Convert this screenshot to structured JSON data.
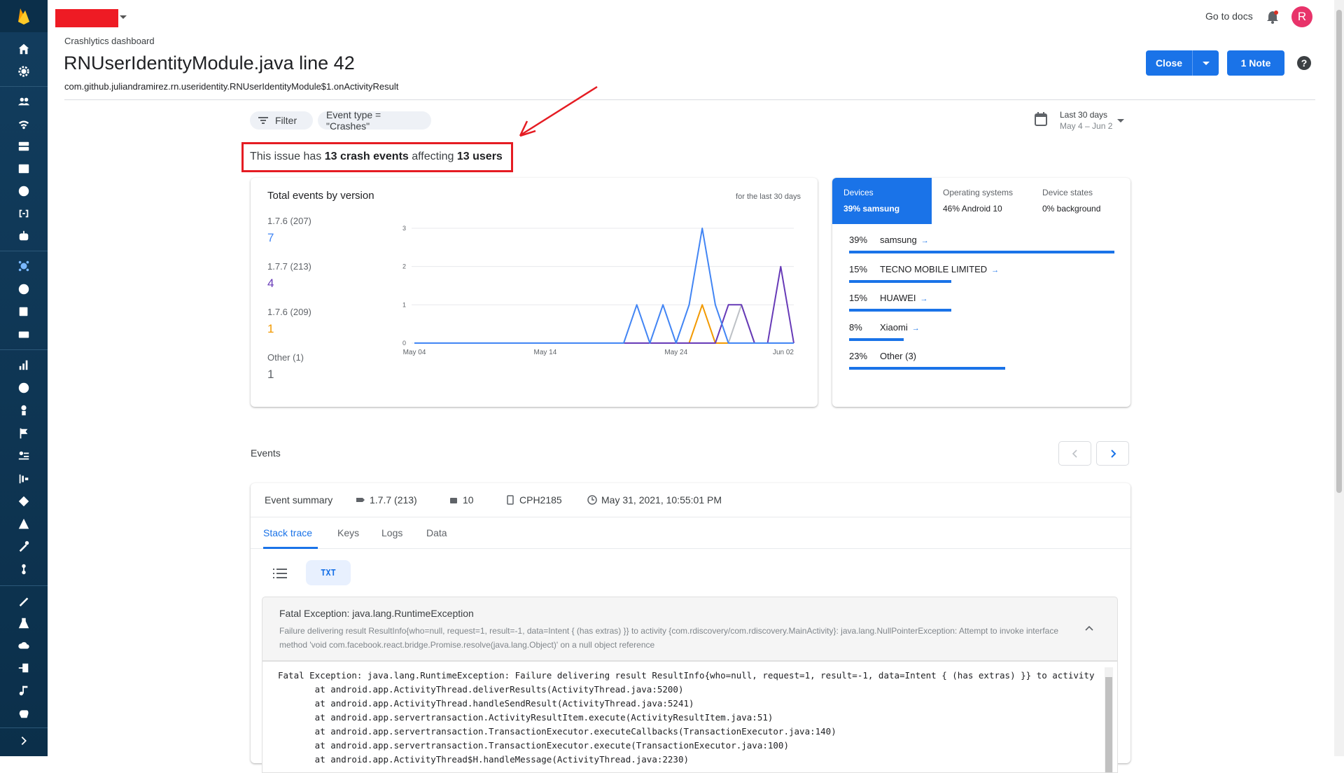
{
  "header": {
    "docs_link": "Go to docs",
    "avatar_letter": "R",
    "breadcrumb": "Crashlytics dashboard",
    "title": "RNUserIdentityModule.java line 42",
    "subtitle": "com.github.juliandramirez.rn.useridentity.RNUserIdentityModule$1.onActivityResult",
    "close_label": "Close",
    "note_label": "1 Note",
    "help_label": "?"
  },
  "filters": {
    "filter_label": "Filter",
    "event_type_label": "Event type = \"Crashes\"",
    "date_range_label": "Last 30 days",
    "date_range_value": "May 4 – Jun 2"
  },
  "summary": {
    "prefix": "This issue has ",
    "crash_events": "13 crash events",
    "middle": " affecting ",
    "users": "13 users"
  },
  "versions_card": {
    "title": "Total events by version",
    "note": "for the last 30 days",
    "versions": [
      {
        "label": "1.7.6 (207)",
        "count": "7",
        "color": "#4285f4"
      },
      {
        "label": "1.7.7 (213)",
        "count": "4",
        "color": "#673ab7"
      },
      {
        "label": "1.7.6 (209)",
        "count": "1",
        "color": "#f29900"
      },
      {
        "label": "Other (1)",
        "count": "1",
        "color": "#5f6368"
      }
    ]
  },
  "chart_data": {
    "type": "line",
    "title": "",
    "xlabel": "",
    "ylabel": "",
    "x": [
      "May 04",
      "May 05",
      "May 06",
      "May 07",
      "May 08",
      "May 09",
      "May 10",
      "May 11",
      "May 12",
      "May 13",
      "May 14",
      "May 15",
      "May 16",
      "May 17",
      "May 18",
      "May 19",
      "May 20",
      "May 21",
      "May 22",
      "May 23",
      "May 24",
      "May 25",
      "May 26",
      "May 27",
      "May 28",
      "May 29",
      "May 30",
      "May 31",
      "Jun 01",
      "Jun 02"
    ],
    "x_tick_labels": [
      "May 04",
      "May 14",
      "May 24",
      "Jun 02"
    ],
    "ylim": [
      0,
      3
    ],
    "y_ticks": [
      0,
      1,
      2,
      3
    ],
    "grid": true,
    "series": [
      {
        "color": "#4285f4",
        "values": [
          0,
          0,
          0,
          0,
          0,
          0,
          0,
          0,
          0,
          0,
          0,
          0,
          0,
          0,
          0,
          0,
          0,
          1,
          0,
          1,
          0,
          1,
          3,
          1,
          0,
          0,
          0,
          0,
          0,
          0
        ]
      },
      {
        "color": "#673ab7",
        "values": [
          0,
          0,
          0,
          0,
          0,
          0,
          0,
          0,
          0,
          0,
          0,
          0,
          0,
          0,
          0,
          0,
          0,
          0,
          0,
          0,
          0,
          0,
          0,
          0,
          1,
          1,
          0,
          0,
          2,
          0
        ]
      },
      {
        "color": "#f29900",
        "values": [
          0,
          0,
          0,
          0,
          0,
          0,
          0,
          0,
          0,
          0,
          0,
          0,
          0,
          0,
          0,
          0,
          0,
          0,
          0,
          0,
          0,
          0,
          1,
          0,
          0,
          0,
          0,
          0,
          0,
          0
        ]
      },
      {
        "color": "#bdc1c6",
        "values": [
          0,
          0,
          0,
          0,
          0,
          0,
          0,
          0,
          0,
          0,
          0,
          0,
          0,
          0,
          0,
          0,
          0,
          0,
          0,
          0,
          0,
          0,
          0,
          0,
          0,
          1,
          0,
          0,
          0,
          0
        ]
      }
    ]
  },
  "devices_card": {
    "tabs": [
      {
        "title": "Devices",
        "value": "39% samsung"
      },
      {
        "title": "Operating systems",
        "value": "46% Android 10"
      },
      {
        "title": "Device states",
        "value": "0% background"
      }
    ],
    "rows": [
      {
        "pct": "39%",
        "name": "samsung",
        "fraction": 0.39,
        "arrow": "→"
      },
      {
        "pct": "15%",
        "name": "TECNO MOBILE LIMITED",
        "fraction": 0.15,
        "arrow": "→"
      },
      {
        "pct": "15%",
        "name": "HUAWEI",
        "fraction": 0.15,
        "arrow": "→"
      },
      {
        "pct": "8%",
        "name": "Xiaomi",
        "fraction": 0.08,
        "arrow": "→"
      },
      {
        "pct": "23%",
        "name": "Other (3)",
        "fraction": 0.23,
        "arrow": ""
      }
    ]
  },
  "events": {
    "label": "Events",
    "summary_label": "Event summary",
    "version": "1.7.7 (213)",
    "os": "10",
    "device": "CPH2185",
    "timestamp": "May 31, 2021, 10:55:01 PM",
    "tabs": [
      "Stack trace",
      "Keys",
      "Logs",
      "Data"
    ],
    "txt_label": "TXT",
    "exception_title": "Fatal Exception: java.lang.RuntimeException",
    "exception_message": "Failure delivering result ResultInfo{who=null, request=1, result=-1, data=Intent { (has extras) }} to activity {com.rdiscovery/com.rdiscovery.MainActivity}: java.lang.NullPointerException: Attempt to invoke interface method 'void com.facebook.react.bridge.Promise.resolve(java.lang.Object)' on a null object reference",
    "trace_lines": [
      "Fatal Exception: java.lang.RuntimeException: Failure delivering result ResultInfo{who=null, request=1, result=-1, data=Intent { (has extras) }} to activity",
      "       at android.app.ActivityThread.deliverResults(ActivityThread.java:5200)",
      "       at android.app.ActivityThread.handleSendResult(ActivityThread.java:5241)",
      "       at android.app.servertransaction.ActivityResultItem.execute(ActivityResultItem.java:51)",
      "       at android.app.servertransaction.TransactionExecutor.executeCallbacks(TransactionExecutor.java:140)",
      "       at android.app.servertransaction.TransactionExecutor.execute(TransactionExecutor.java:100)",
      "       at android.app.ActivityThread$H.handleMessage(ActivityThread.java:2230)"
    ]
  }
}
